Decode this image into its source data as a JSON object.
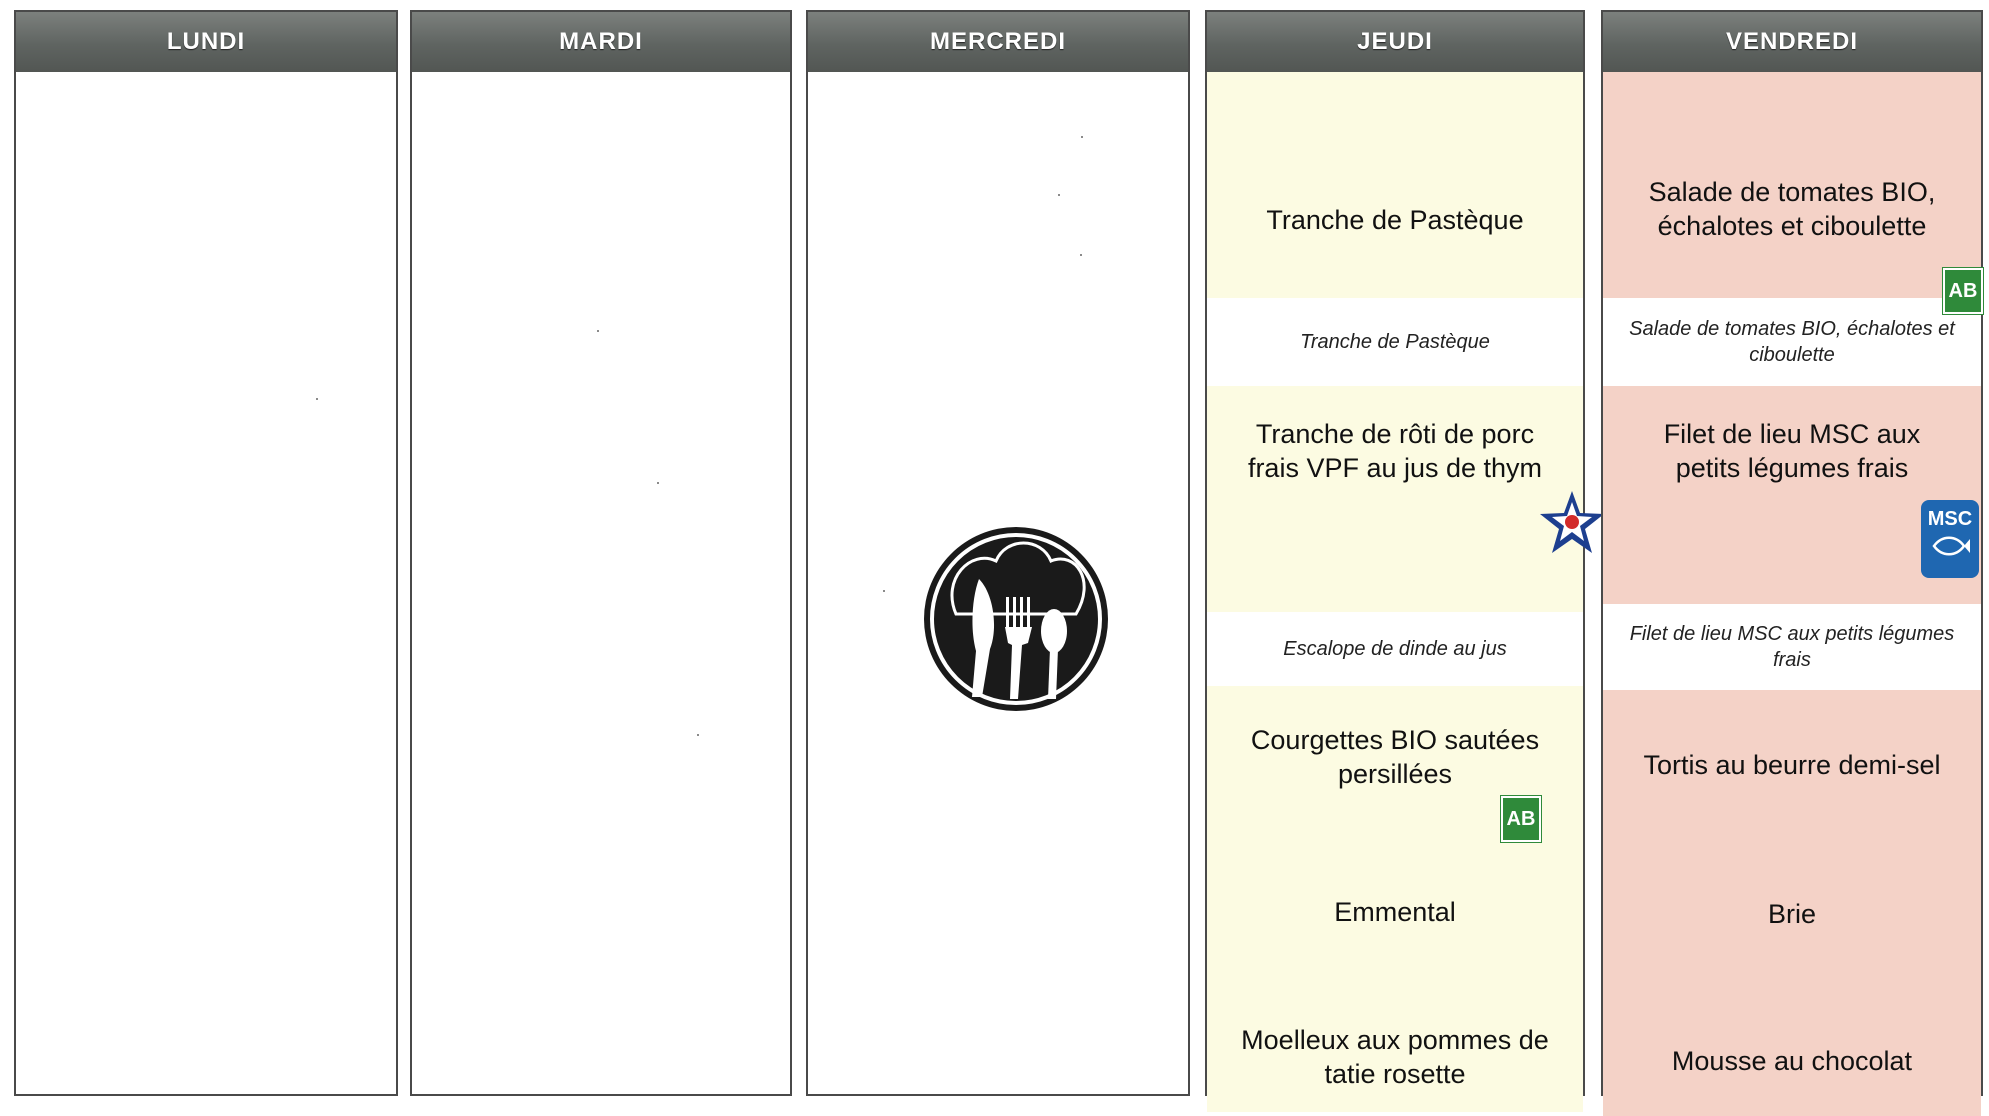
{
  "days": {
    "lundi": "LUNDI",
    "mardi": "MARDI",
    "mercredi": "MERCREDI",
    "jeudi": "JEUDI",
    "vendredi": "VENDREDI"
  },
  "jeudi": {
    "entree": "Tranche de Pastèque",
    "entree_alt": "Tranche de Pastèque",
    "plat": "Tranche de rôti de porc frais VPF au jus de thym",
    "plat_alt": "Escalope de dinde au jus",
    "accompagnement": "Courgettes BIO sautées persillées",
    "fromage": "Emmental",
    "dessert": "Moelleux aux pommes de tatie rosette"
  },
  "vendredi": {
    "entree": "Salade de tomates BIO, échalotes et ciboulette",
    "entree_alt": "Salade de tomates BIO, échalotes et ciboulette",
    "plat": "Filet de lieu MSC aux petits légumes frais",
    "plat_alt": "Filet de lieu MSC aux petits légumes frais",
    "accompagnement": "Tortis au beurre demi-sel",
    "fromage": "Brie",
    "dessert": "Mousse au chocolat"
  },
  "labels": {
    "ab": "AB",
    "msc": "MSC"
  },
  "colors": {
    "header": "#5f6461",
    "jeudi_bg": "#fcfbe2",
    "vendredi_bg": "#f4d2c7",
    "ab_green": "#2f8a3a",
    "msc_blue": "#1f67b1"
  }
}
